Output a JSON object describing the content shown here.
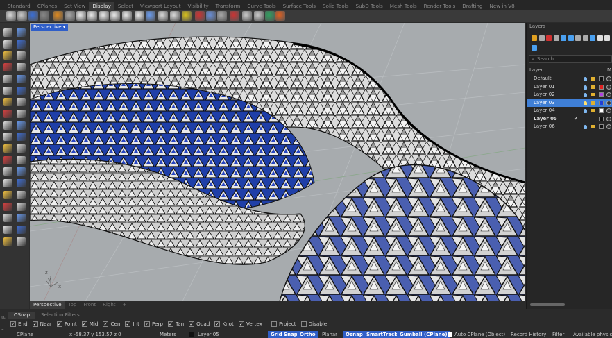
{
  "ribbon_tabs": [
    {
      "label": "Standard",
      "active": false
    },
    {
      "label": "CPlanes",
      "active": false
    },
    {
      "label": "Set View",
      "active": false
    },
    {
      "label": "Display",
      "active": true
    },
    {
      "label": "Select",
      "active": false
    },
    {
      "label": "Viewport Layout",
      "active": false
    },
    {
      "label": "Visibility",
      "active": false
    },
    {
      "label": "Transform",
      "active": false
    },
    {
      "label": "Curve Tools",
      "active": false
    },
    {
      "label": "Surface Tools",
      "active": false
    },
    {
      "label": "Solid Tools",
      "active": false
    },
    {
      "label": "SubD Tools",
      "active": false
    },
    {
      "label": "Mesh Tools",
      "active": false
    },
    {
      "label": "Render Tools",
      "active": false
    },
    {
      "label": "Drafting",
      "active": false
    },
    {
      "label": "New in V8",
      "active": false
    }
  ],
  "viewport": {
    "title": "Perspective",
    "axis_x": "x",
    "axis_y": "y",
    "axis_z": "z",
    "accent": "#2f5ec8",
    "mesh_blue": "#1f3fa8"
  },
  "viewport_tabs": [
    {
      "label": "Perspective",
      "active": true
    },
    {
      "label": "Top",
      "active": false
    },
    {
      "label": "Front",
      "active": false
    },
    {
      "label": "Right",
      "active": false
    },
    {
      "label": "+",
      "active": false
    }
  ],
  "layers_panel": {
    "title": "Layers",
    "search_placeholder": "Search",
    "col_layer": "Layer",
    "col_m": "M",
    "rows": [
      {
        "name": "Default",
        "color": "#111111",
        "selected": false,
        "current": false
      },
      {
        "name": "Layer 01",
        "color": "#e02020",
        "selected": false,
        "current": false
      },
      {
        "name": "Layer 02",
        "color": "#b040e0",
        "selected": false,
        "current": false
      },
      {
        "name": "Layer 03",
        "color": "#1f3fd8",
        "selected": true,
        "current": false
      },
      {
        "name": "Layer 04",
        "color": "#ffffff",
        "selected": false,
        "current": false
      },
      {
        "name": "Layer 05",
        "color": "#111111",
        "selected": false,
        "current": true
      },
      {
        "name": "Layer 06",
        "color": "#111111",
        "selected": false,
        "current": false
      }
    ]
  },
  "osnap_tabs": [
    {
      "label": "OSnap",
      "active": true
    },
    {
      "label": "Selection Filters",
      "active": false
    }
  ],
  "osnap_side_label": "OSnap",
  "snaps": [
    {
      "label": "End",
      "checked": true
    },
    {
      "label": "Near",
      "checked": true
    },
    {
      "label": "Point",
      "checked": true
    },
    {
      "label": "Mid",
      "checked": true
    },
    {
      "label": "Cen",
      "checked": true
    },
    {
      "label": "Int",
      "checked": true
    },
    {
      "label": "Perp",
      "checked": true
    },
    {
      "label": "Tan",
      "checked": true
    },
    {
      "label": "Quad",
      "checked": true
    },
    {
      "label": "Knot",
      "checked": true
    },
    {
      "label": "Vertex",
      "checked": true
    },
    {
      "label": "Project",
      "checked": false
    },
    {
      "label": "Disable",
      "checked": false
    }
  ],
  "status": {
    "cplane": "CPlane",
    "coords": "x -58.37  y 153.57  z 0",
    "units": "Meters",
    "layer": "Layer 05",
    "grid_snap": "Grid Snap",
    "ortho": "Ortho",
    "planar": "Planar",
    "osnap": "Osnap",
    "smarttrack": "SmartTrack",
    "gumball": "Gumball (CPlane)",
    "auto_cplane": "Auto CPlane (Object)",
    "record_history": "Record History",
    "filter": "Filter",
    "available": "Available physica"
  }
}
